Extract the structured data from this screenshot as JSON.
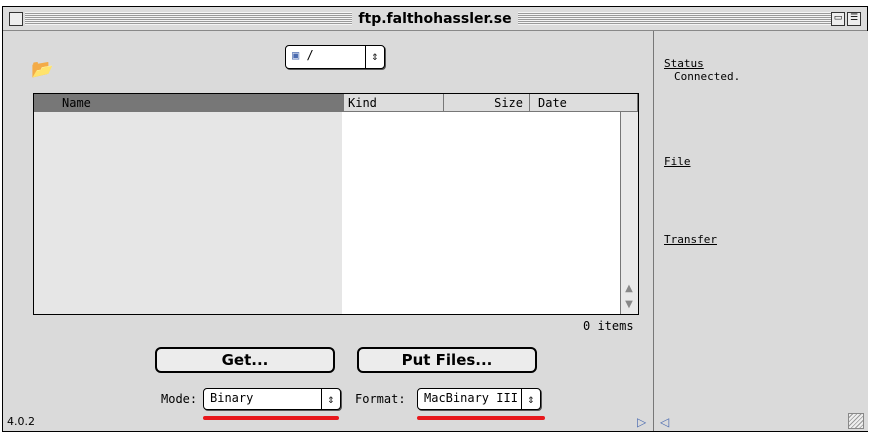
{
  "window": {
    "title": "ftp.falthohassler.se",
    "version": "4.0.2"
  },
  "path_popup": {
    "value": "/"
  },
  "list": {
    "columns": [
      "Name",
      "Kind",
      "Size",
      "Date"
    ],
    "items_count": "0 items"
  },
  "buttons": {
    "get": "Get...",
    "put": "Put Files..."
  },
  "mode": {
    "label": "Mode:",
    "value": "Binary"
  },
  "format": {
    "label": "Format:",
    "value": "MacBinary III"
  },
  "sidebar": {
    "status_label": "Status",
    "status_value": "Connected.",
    "file_label": "File",
    "transfer_label": "Transfer"
  },
  "icons": {
    "folder": "folder-icon",
    "popup_arrows": "up-down-arrows-icon",
    "scroll_up": "arrow-up-icon",
    "scroll_down": "arrow-down-icon",
    "collapse": "right-triangle-icon",
    "expand": "left-triangle-icon"
  },
  "colors": {
    "underline": "#e8181c",
    "window": "#dadada"
  }
}
